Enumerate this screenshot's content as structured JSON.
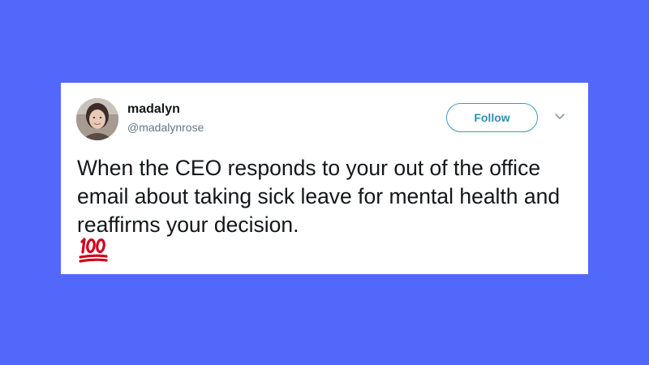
{
  "tweet": {
    "author": {
      "display_name": "madalyn",
      "handle": "@madalynrose"
    },
    "follow_label": "Follow",
    "text": "When the CEO responds to your out of the office email about taking sick leave for mental health and reaffirms your decision.",
    "emoji": "hundred-points-emoji"
  },
  "colors": {
    "background": "#5268fb",
    "card": "#ffffff",
    "follow_accent": "#2f8fb5",
    "emoji_red": "#d0021b"
  },
  "icons": {
    "menu": "chevron-down-icon",
    "avatar": "avatar"
  }
}
